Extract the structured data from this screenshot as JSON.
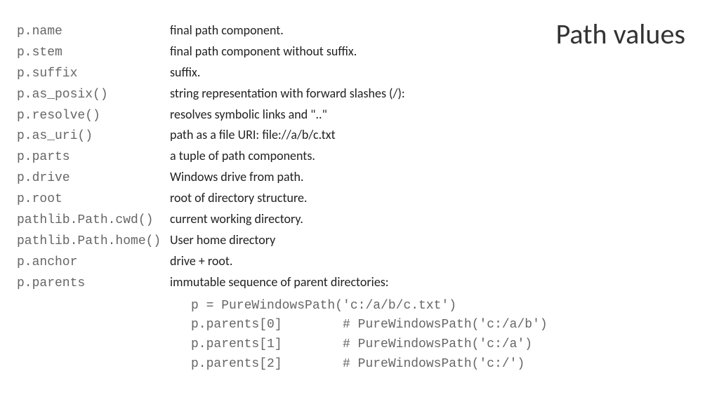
{
  "title": "Path values",
  "rows": [
    {
      "code": "p.name",
      "desc": "final path component."
    },
    {
      "code": "p.stem",
      "desc": "final path component without suffix."
    },
    {
      "code": "p.suffix",
      "desc": "suffix."
    },
    {
      "code": "p.as_posix()",
      "desc": "string representation with forward slashes (/):"
    },
    {
      "code": "p.resolve()",
      "desc": "resolves symbolic links and \"..\""
    },
    {
      "code": "p.as_uri()",
      "desc": "path as a file URI: file://a/b/c.txt"
    },
    {
      "code": "p.parts",
      "desc": "a tuple of path components."
    },
    {
      "code": "p.drive",
      "desc": "Windows drive from path."
    },
    {
      "code": "p.root",
      "desc": "root of directory structure."
    },
    {
      "code": "pathlib.Path.cwd()",
      "desc": "current working directory."
    },
    {
      "code": "pathlib.Path.home()",
      "desc": "User home directory"
    },
    {
      "code": "p.anchor",
      "desc": "drive + root."
    },
    {
      "code": "p.parents",
      "desc": "immutable sequence of parent directories:"
    }
  ],
  "examples": [
    "p = PureWindowsPath('c:/a/b/c.txt')",
    "p.parents[0]        # PureWindowsPath('c:/a/b')",
    "p.parents[1]        # PureWindowsPath('c:/a')",
    "p.parents[2]        # PureWindowsPath('c:/')"
  ]
}
